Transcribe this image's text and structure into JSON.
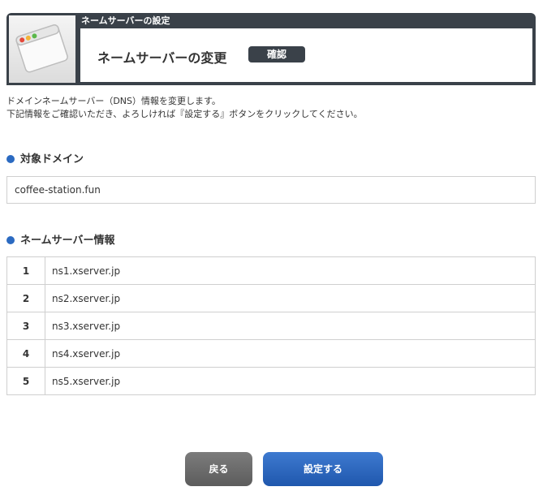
{
  "header": {
    "caption": "ネームサーバーの設定",
    "title": "ネームサーバーの変更",
    "badge": "確認",
    "icon": "window-icon"
  },
  "description": {
    "line1": "ドメインネームサーバー（DNS）情報を変更します。",
    "line2": "下記情報をご確認いただき、よろしければ『設定する』ボタンをクリックしてください。"
  },
  "domain_section": {
    "title": "対象ドメイン",
    "value": "coffee-station.fun"
  },
  "ns_section": {
    "title": "ネームサーバー情報",
    "rows": [
      {
        "num": "1",
        "value": "ns1.xserver.jp"
      },
      {
        "num": "2",
        "value": "ns2.xserver.jp"
      },
      {
        "num": "3",
        "value": "ns3.xserver.jp"
      },
      {
        "num": "4",
        "value": "ns4.xserver.jp"
      },
      {
        "num": "5",
        "value": "ns5.xserver.jp"
      }
    ]
  },
  "buttons": {
    "back": "戻る",
    "submit": "設定する"
  },
  "colors": {
    "panel": "#3a4149",
    "accent": "#2b6ac1"
  }
}
